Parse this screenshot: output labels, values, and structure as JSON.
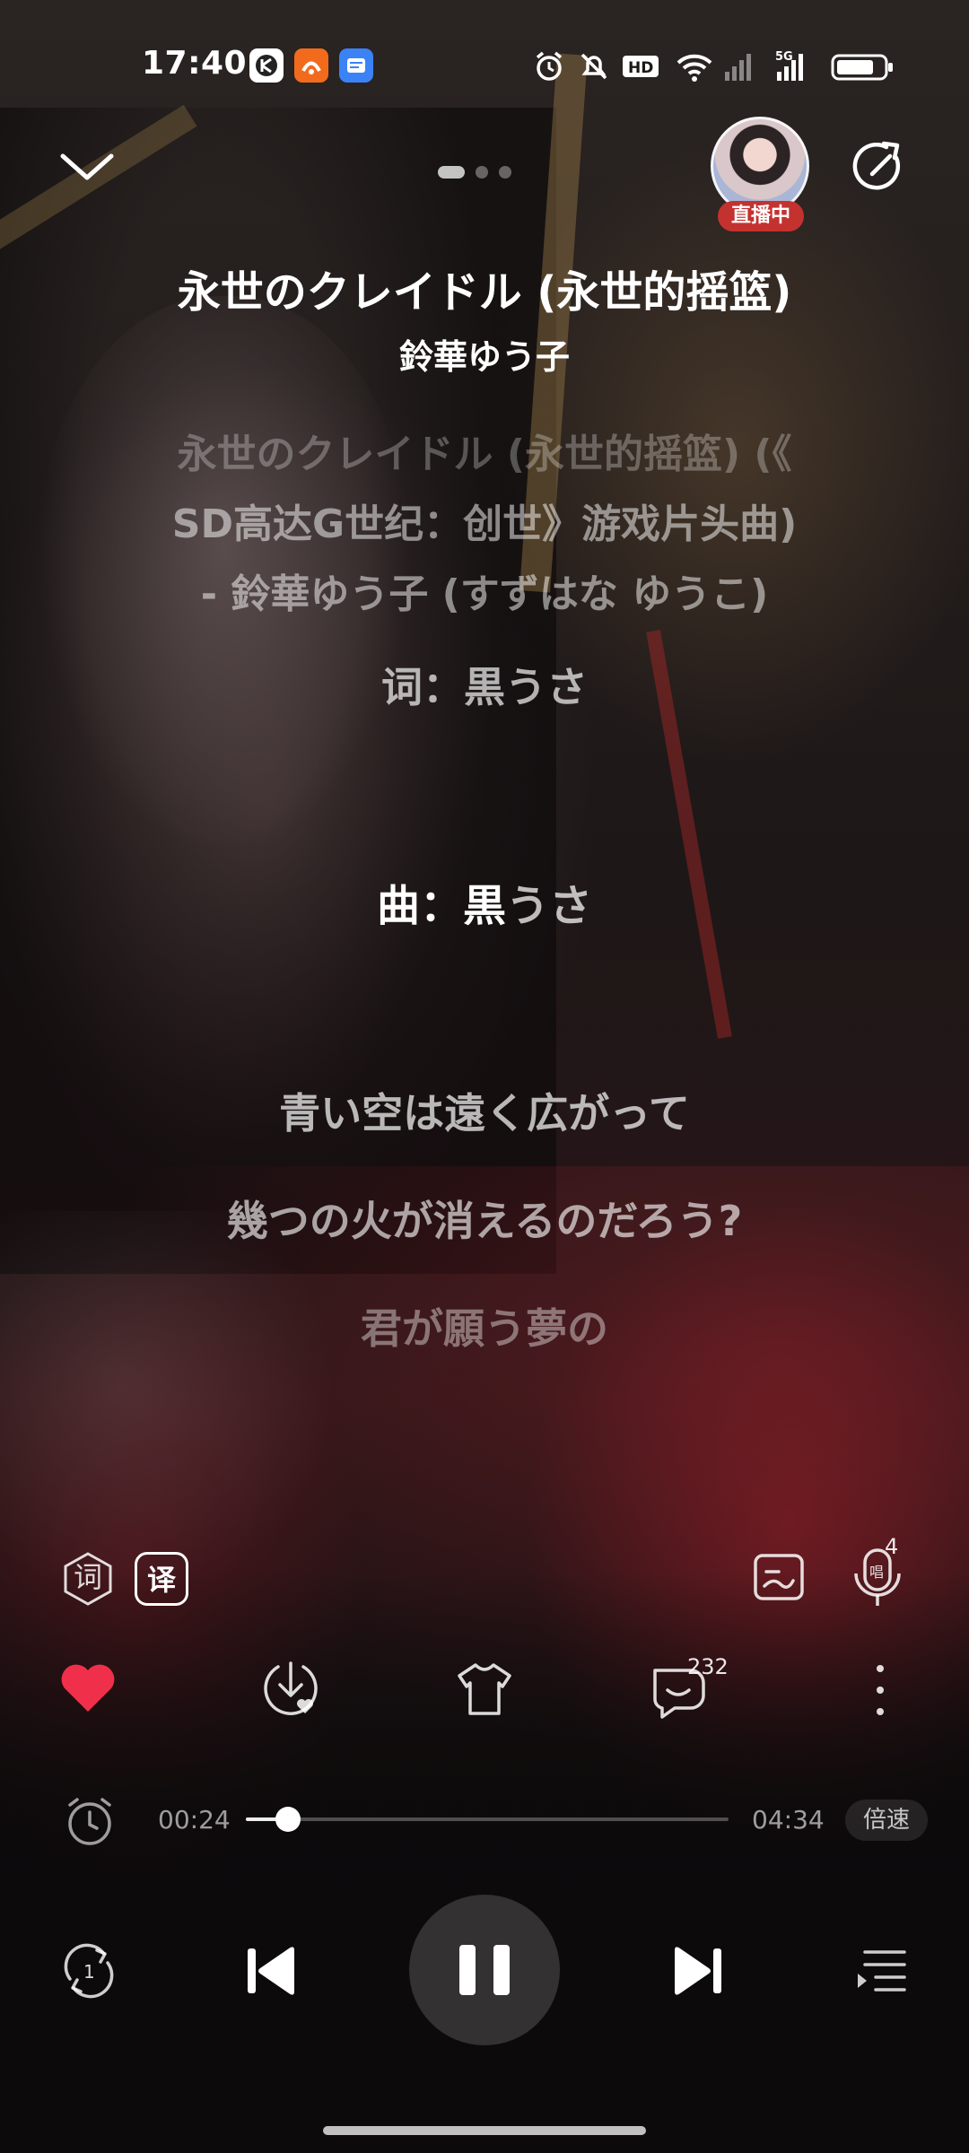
{
  "status_bar": {
    "time": "17:40",
    "app_icons": [
      {
        "name": "kuaishou-icon",
        "color": "#ffffff"
      },
      {
        "name": "shopping-app-icon",
        "color": "#f26b1d"
      },
      {
        "name": "message-app-icon",
        "color": "#3b82f6"
      }
    ],
    "system_icons": [
      "alarm-icon",
      "mute-icon",
      "hd-icon",
      "wifi-icon",
      "signal-icon",
      "battery-icon"
    ],
    "hd_label": "HD",
    "network_label": "5G",
    "battery_level": 0.8
  },
  "header": {
    "collapse_icon": "chevron-down-icon",
    "page_count": 3,
    "active_page": 0,
    "live_badge": "直播中",
    "share_icon": "share-icon"
  },
  "song": {
    "title": "永世のクレイドル (永世的摇篮)",
    "artist": "鈴華ゆう子"
  },
  "lyrics": {
    "info_line1_faded": "永世のクレイドル (永世的摇篮) (《",
    "info_line2": "SD高达G世纪：创世》游戏片头曲)",
    "info_line3": "- 鈴華ゆう子 (すずはな ゆうこ)",
    "credit_lyrics": "词：黒うさ",
    "credit_music_highlight": "曲：黒",
    "credit_music_rest": "うさ",
    "line1": "青い空は遠く広がって",
    "line2": "幾つの火が消えるのだろう?",
    "line3": "君が願う夢の"
  },
  "lyric_controls": {
    "lyrics_toggle": "词",
    "translate_toggle": "译",
    "sing_badge": "4"
  },
  "actions": {
    "like_color": "#f0304a",
    "comment_count": "232"
  },
  "progress": {
    "current": "00:24",
    "total": "04:34",
    "fraction": 0.0876,
    "speed_label": "倍速"
  },
  "playback": {
    "repeat_mode": "1"
  }
}
